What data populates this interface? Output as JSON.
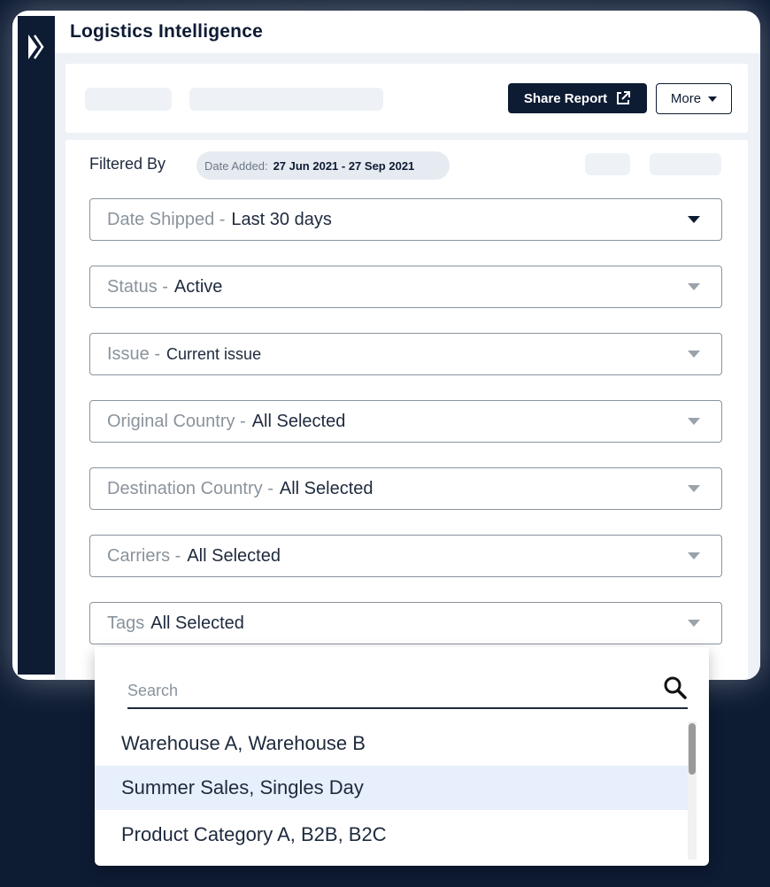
{
  "app": {
    "title": "Logistics Intelligence"
  },
  "toolbar": {
    "share_label": "Share Report",
    "more_label": "More"
  },
  "filters": {
    "filtered_by_label": "Filtered By",
    "chip": {
      "label": "Date Added:",
      "value": "27 Jun 2021 - 27 Sep 2021"
    },
    "fields": [
      {
        "key": "Date Shipped -",
        "value": "Last 30 days"
      },
      {
        "key": "Status -",
        "value": "Active"
      },
      {
        "key": "Issue -",
        "value": "Current issue"
      },
      {
        "key": "Original Country -",
        "value": "All Selected"
      },
      {
        "key": "Destination Country -",
        "value": "All Selected"
      },
      {
        "key": "Carriers -",
        "value": "All Selected"
      },
      {
        "key": "Tags",
        "value": "All Selected"
      }
    ]
  },
  "dropdown": {
    "search_placeholder": "Search",
    "options": [
      "Warehouse A, Warehouse B",
      "Summer Sales, Singles Day",
      "Product Category A, B2B, B2C"
    ],
    "highlighted_index": 1
  },
  "icons": {
    "sidebar_toggle": "chevron-right-icon",
    "share": "external-link-icon",
    "more": "caret-down-icon",
    "field_caret": "caret-down-icon",
    "search": "search-icon"
  },
  "colors": {
    "navy": "#0d1b33",
    "border": "#8a939c",
    "highlight": "#e6effb"
  }
}
